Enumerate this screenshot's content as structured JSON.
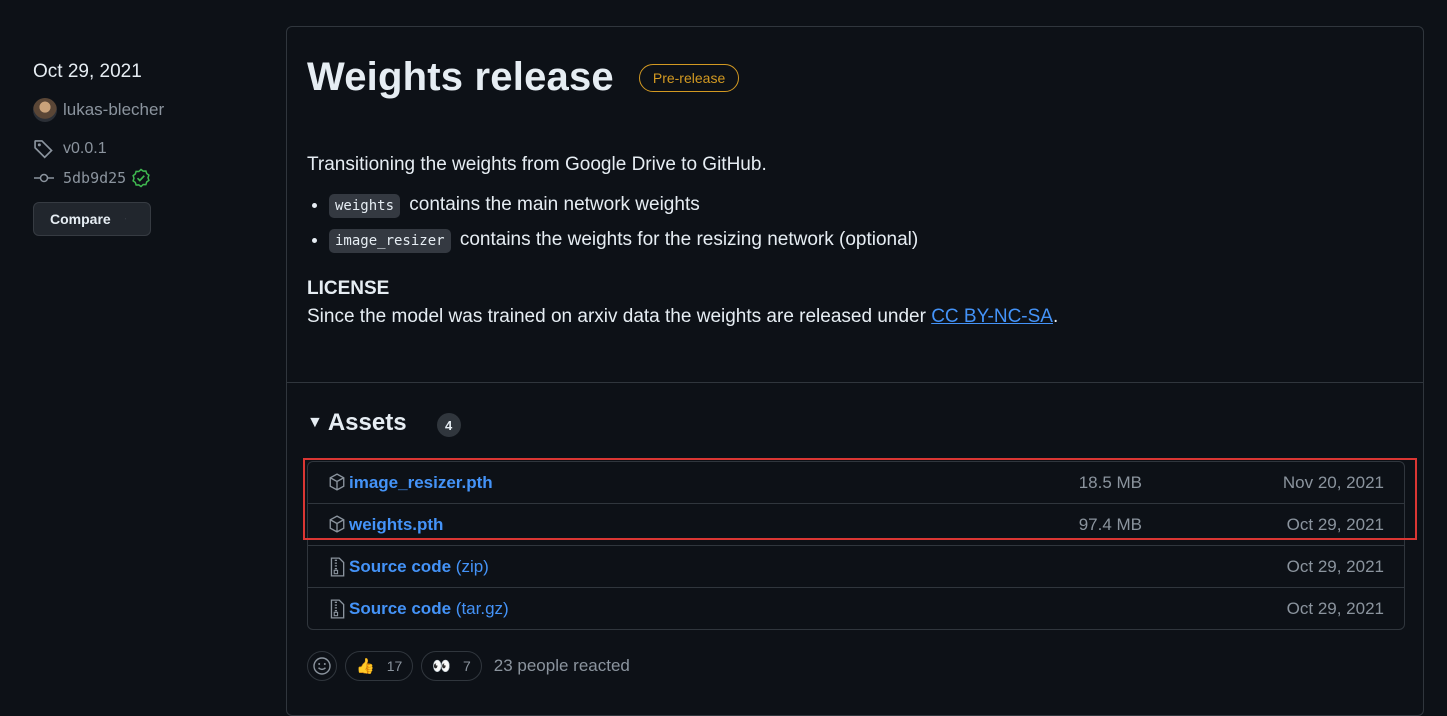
{
  "sidebar": {
    "date": "Oct 29, 2021",
    "author": "lukas-blecher",
    "tag": "v0.0.1",
    "commit": "5db9d25",
    "compare_label": "Compare"
  },
  "release": {
    "title": "Weights release",
    "badge": "Pre-release",
    "intro": "Transitioning the weights from Google Drive to GitHub.",
    "bullets": [
      {
        "code": "weights",
        "text": "contains the main network weights"
      },
      {
        "code": "image_resizer",
        "text": "contains the weights for the resizing network (optional)"
      }
    ],
    "license_heading": "LICENSE",
    "license_text": "Since the model was trained on arxiv data the weights are released under",
    "license_link": "CC BY-NC-SA",
    "license_end": "."
  },
  "assets": {
    "title": "Assets",
    "count": "4",
    "items": [
      {
        "name": "image_resizer.pth",
        "suffix": "",
        "size": "18.5 MB",
        "date": "Nov 20, 2021",
        "icon": "package-icon"
      },
      {
        "name": "weights.pth",
        "suffix": "",
        "size": "97.4 MB",
        "date": "Oct 29, 2021",
        "icon": "package-icon"
      },
      {
        "name": "Source code",
        "suffix": "(zip)",
        "size": "",
        "date": "Oct 29, 2021",
        "icon": "file-zip-icon"
      },
      {
        "name": "Source code",
        "suffix": "(tar.gz)",
        "size": "",
        "date": "Oct 29, 2021",
        "icon": "file-zip-icon"
      }
    ]
  },
  "reactions": {
    "thumbs_emoji": "👍",
    "thumbs_count": "17",
    "eyes_emoji": "👀",
    "eyes_count": "7",
    "summary": "23 people reacted"
  },
  "colors": {
    "accent": "#4493f8",
    "prerelease": "#d29922",
    "highlight": "#da3633",
    "verified": "#3fb950"
  }
}
